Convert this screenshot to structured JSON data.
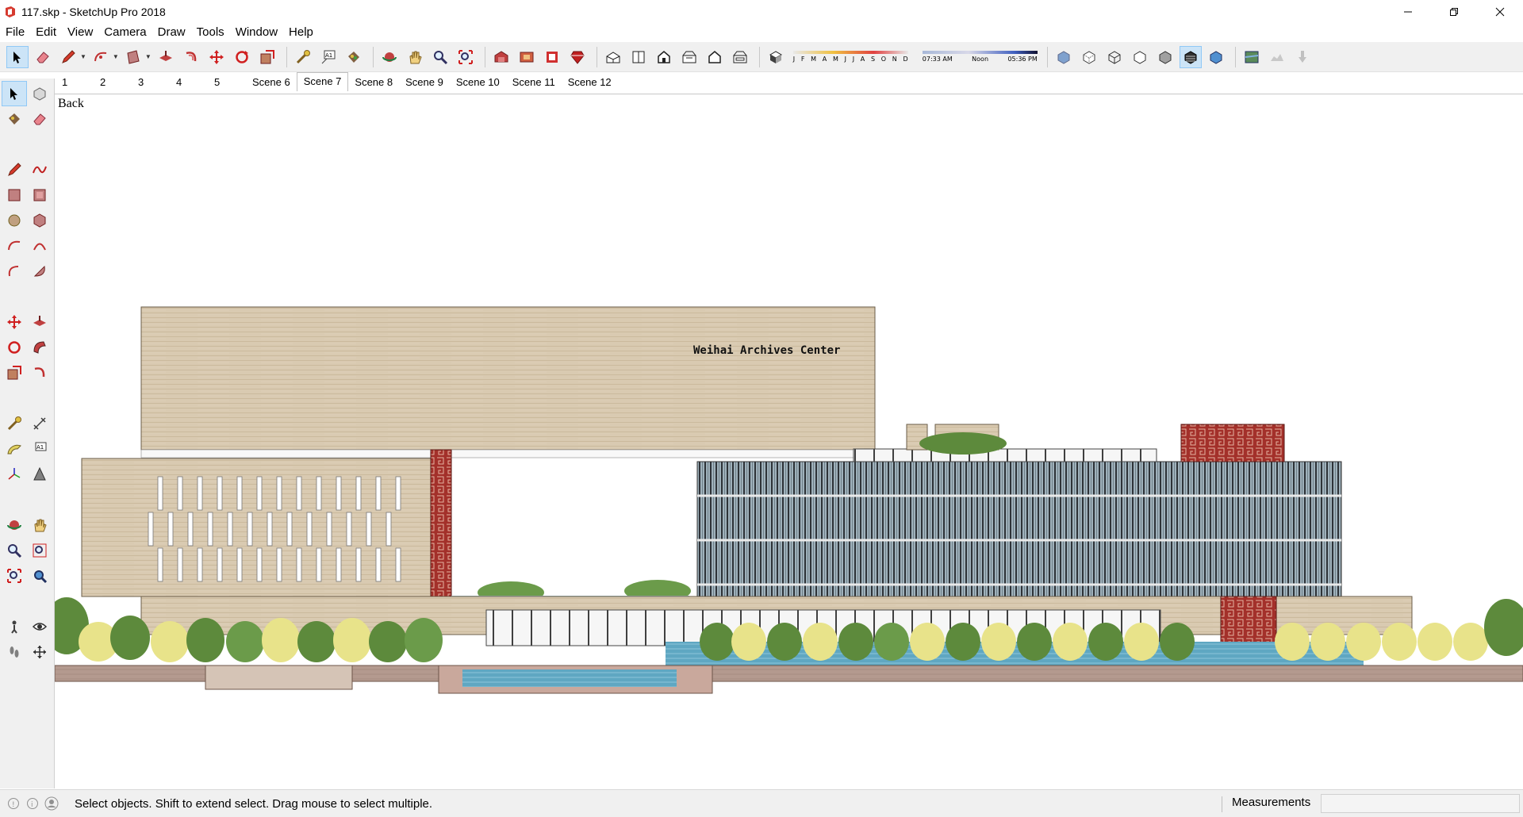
{
  "window": {
    "title": "117.skp - SketchUp Pro 2018",
    "controls": [
      "minimize",
      "restore",
      "close"
    ]
  },
  "menu": [
    "File",
    "Edit",
    "View",
    "Camera",
    "Draw",
    "Tools",
    "Window",
    "Help"
  ],
  "shadow_settings": {
    "months": [
      "J",
      "F",
      "M",
      "A",
      "M",
      "J",
      "J",
      "A",
      "S",
      "O",
      "N",
      "D"
    ],
    "time_start": "07:33 AM",
    "time_mid": "Noon",
    "time_end": "05:36 PM"
  },
  "scenes": {
    "tabs": [
      "1",
      "2",
      "3",
      "4",
      "5",
      "Scene 6",
      "Scene 7",
      "Scene 8",
      "Scene 9",
      "Scene 10",
      "Scene 11",
      "Scene 12"
    ],
    "active": "Scene 7"
  },
  "viewport": {
    "view_name": "Back",
    "building_sign": "Weihai Archives Center"
  },
  "status": {
    "hint": "Select objects. Shift to extend select. Drag mouse to select multiple.",
    "measurements_label": "Measurements",
    "measurements_value": ""
  },
  "colors": {
    "stone": "#d9cab1",
    "stone_dark": "#c9b89c",
    "red_panel": "#a3302a",
    "glass_facade": "#8fa3b0",
    "water": "#5fa7c2",
    "tree_green": "#5d8a3c",
    "tree_yellow": "#e8e38a",
    "ground": "#b49a8f",
    "selection_blue": "#cce4f7"
  }
}
